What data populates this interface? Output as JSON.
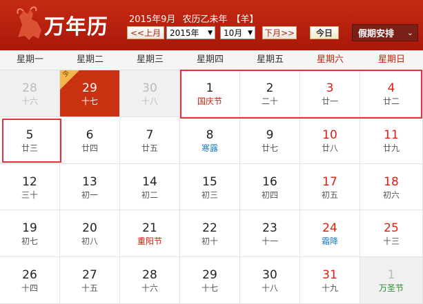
{
  "header": {
    "brand": "万年历",
    "date_solar": "2015年9月",
    "date_lunar": "农历乙未年",
    "zodiac": "【羊】",
    "prev_label": "<<上月",
    "next_label": "下月>>",
    "year_value": "2015年",
    "month_value": "10月",
    "today_label": "今日",
    "holiday_label": "假期安排",
    "logo_icon": "goat-logo-icon",
    "brand_color": "#c62a12"
  },
  "weekdays": [
    "星期一",
    "星期二",
    "星期三",
    "星期四",
    "星期五",
    "星期六",
    "星期日"
  ],
  "today_badge": "今",
  "weeks": [
    [
      {
        "day": "28",
        "lunar": "十六",
        "other": true
      },
      {
        "day": "29",
        "lunar": "十七",
        "today": true
      },
      {
        "day": "30",
        "lunar": "十八",
        "other": true
      },
      {
        "day": "1",
        "lunar": "国庆节",
        "kind": "festival-red"
      },
      {
        "day": "2",
        "lunar": "二十"
      },
      {
        "day": "3",
        "lunar": "廿一"
      },
      {
        "day": "4",
        "lunar": "廿二"
      }
    ],
    [
      {
        "day": "5",
        "lunar": "廿三"
      },
      {
        "day": "6",
        "lunar": "廿四"
      },
      {
        "day": "7",
        "lunar": "廿五"
      },
      {
        "day": "8",
        "lunar": "寒露",
        "kind": "term"
      },
      {
        "day": "9",
        "lunar": "廿七"
      },
      {
        "day": "10",
        "lunar": "廿八"
      },
      {
        "day": "11",
        "lunar": "廿九"
      }
    ],
    [
      {
        "day": "12",
        "lunar": "三十"
      },
      {
        "day": "13",
        "lunar": "初一"
      },
      {
        "day": "14",
        "lunar": "初二"
      },
      {
        "day": "15",
        "lunar": "初三"
      },
      {
        "day": "16",
        "lunar": "初四"
      },
      {
        "day": "17",
        "lunar": "初五"
      },
      {
        "day": "18",
        "lunar": "初六"
      }
    ],
    [
      {
        "day": "19",
        "lunar": "初七"
      },
      {
        "day": "20",
        "lunar": "初八"
      },
      {
        "day": "21",
        "lunar": "重阳节",
        "kind": "festival-red"
      },
      {
        "day": "22",
        "lunar": "初十"
      },
      {
        "day": "23",
        "lunar": "十一"
      },
      {
        "day": "24",
        "lunar": "霜降",
        "kind": "term"
      },
      {
        "day": "25",
        "lunar": "十三"
      }
    ],
    [
      {
        "day": "26",
        "lunar": "十四"
      },
      {
        "day": "27",
        "lunar": "十五"
      },
      {
        "day": "28",
        "lunar": "十六"
      },
      {
        "day": "29",
        "lunar": "十七"
      },
      {
        "day": "30",
        "lunar": "十八"
      },
      {
        "day": "31",
        "lunar": "十九"
      },
      {
        "day": "1",
        "lunar": "万圣节",
        "other": true,
        "kind": "festival-green"
      }
    ]
  ]
}
